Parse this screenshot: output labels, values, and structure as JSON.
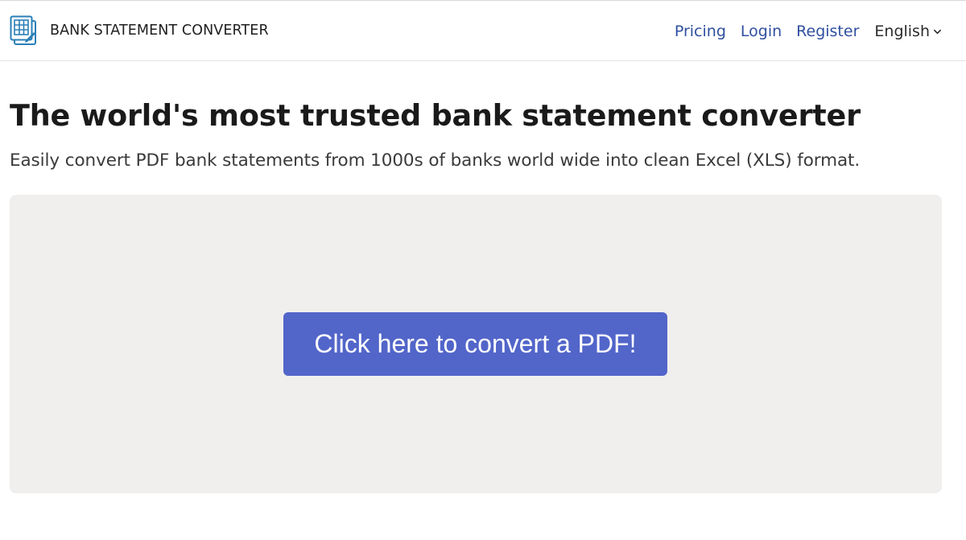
{
  "header": {
    "brand_name": "BANK STATEMENT CONVERTER",
    "brand_icon": "spreadsheet-document-icon",
    "nav": {
      "pricing": "Pricing",
      "login": "Login",
      "register": "Register"
    },
    "language": {
      "selected": "English",
      "icon": "chevron-down-icon"
    }
  },
  "hero": {
    "title": "The world's most trusted bank statement converter",
    "subtitle": "Easily convert PDF bank statements from 1000s of banks world wide into clean Excel (XLS) format."
  },
  "upload": {
    "button_label": "Click here to convert a PDF!"
  },
  "colors": {
    "link": "#2f4f9f",
    "accent_button": "#5265c9",
    "drop_zone_bg": "#f0efee",
    "logo": "#2a7fb8"
  }
}
